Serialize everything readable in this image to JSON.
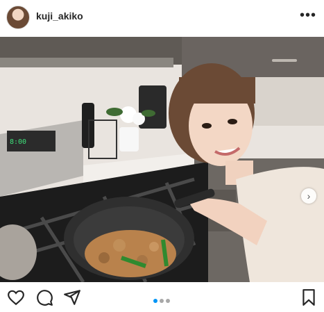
{
  "post": {
    "username": "kuji_akiko",
    "more_label": "•••",
    "next_label": "›"
  },
  "carousel": {
    "total": 3,
    "active_index": 0
  },
  "icons": {
    "like": "heart-icon",
    "comment": "comment-icon",
    "share": "share-icon",
    "save": "bookmark-icon",
    "more": "more-options-icon",
    "next": "chevron-right-icon"
  },
  "colors": {
    "accent": "#0095f6",
    "text": "#262626",
    "dot_inactive": "#a8a8a8"
  }
}
